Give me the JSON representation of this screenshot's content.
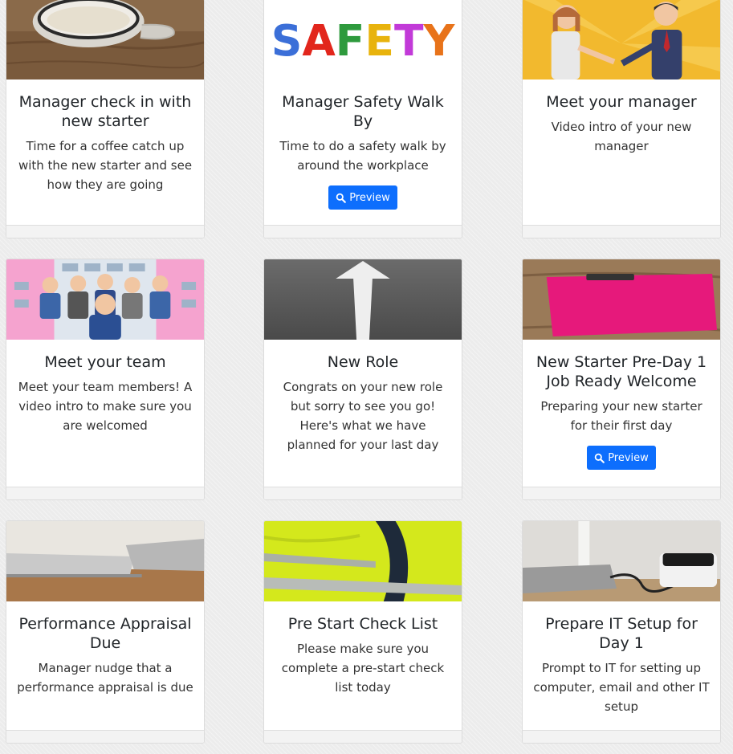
{
  "cards": [
    {
      "title": "Manager check in with new starter",
      "text": "Time for a coffee catch up with the new starter and see how they are going",
      "image": "coffee-cup-photo"
    },
    {
      "title": "Manager Safety Walk By",
      "text": "Time to do a safety walk by around the workplace",
      "image": "safety-logo",
      "button": "Preview",
      "logo_text": "SAFETY"
    },
    {
      "title": "Meet your manager",
      "text": "Video intro of your new manager",
      "image": "handshake-illustration"
    },
    {
      "title": "Meet your team",
      "text": "Meet your team members! A video intro to make sure you are welcomed",
      "image": "team-illustration"
    },
    {
      "title": "New Role",
      "text": "Congrats on your new role but sorry to see you go! Here's what we have planned for your last day",
      "image": "road-arrow-photo"
    },
    {
      "title": "New Starter Pre-Day 1 Job Ready Welcome",
      "text": "Preparing your new starter for their first day",
      "image": "pink-clipboard-photo",
      "button": "Preview"
    },
    {
      "title": "Performance Appraisal Due",
      "text": "Manager nudge that a performance appraisal is due",
      "image": "laptop-photo"
    },
    {
      "title": "Pre Start Check List",
      "text": "Please make sure you complete a pre-start check list today",
      "image": "hi-vis-vest-photo"
    },
    {
      "title": "Prepare IT Setup for Day 1",
      "text": "Prompt to IT for setting up computer, email and other IT setup",
      "image": "printer-laptop-photo"
    }
  ],
  "colors": {
    "accent": "#0d6efd",
    "safety_letters": [
      "#3b6fd8",
      "#e2261c",
      "#2e9a3d",
      "#e8b30d",
      "#c23ad8",
      "#e8731a"
    ]
  }
}
